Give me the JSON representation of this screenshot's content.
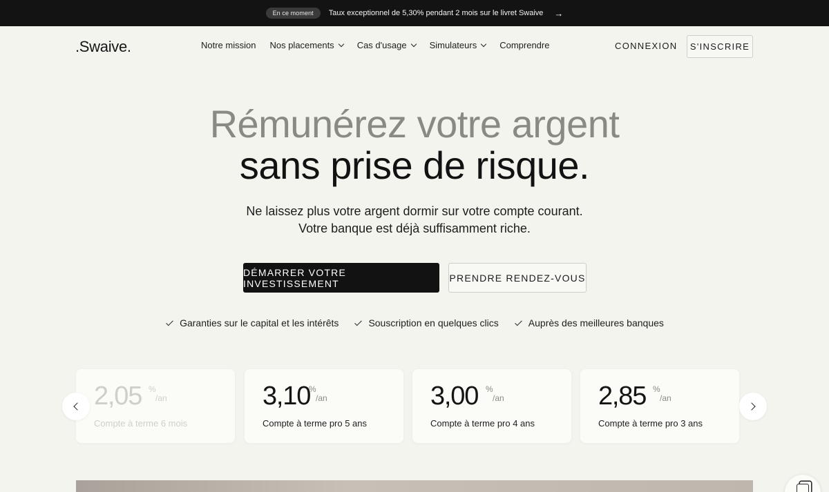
{
  "banner": {
    "badge": "En ce moment",
    "message": "Taux exceptionnel de 5,30% pendant 2 mois sur le livret Swaive",
    "arrow": "→"
  },
  "header": {
    "logo": ".Swaive.",
    "nav": [
      {
        "label": "Notre mission",
        "dropdown": false
      },
      {
        "label": "Nos placements",
        "dropdown": true
      },
      {
        "label": "Cas d'usage",
        "dropdown": true
      },
      {
        "label": "Simulateurs",
        "dropdown": true
      },
      {
        "label": "Comprendre",
        "dropdown": false
      }
    ],
    "login": "CONNEXION",
    "signup": "S'INSCRIRE"
  },
  "hero": {
    "line1": "Rémunérez votre argent",
    "line2": "sans prise de risque.",
    "sub1": "Ne laissez plus votre argent dormir sur votre compte courant.",
    "sub2": "Votre banque est déjà suffisamment riche.",
    "cta_primary": "DÉMARRER VOTRE INVESTISSEMENT",
    "cta_secondary": "PRENDRE RENDEZ-VOUS"
  },
  "features": [
    "Garanties sur le capital et les intérêts",
    "Souscription en quelques clics",
    "Auprès des meilleures banques"
  ],
  "cards": [
    {
      "rate": "2,05",
      "unit_pct": "%",
      "unit_per": "/an",
      "label": "Compte à terme 6 mois"
    },
    {
      "rate": "3,10",
      "unit_pct": "%",
      "unit_per": "/an",
      "label": "Compte à terme pro 5 ans"
    },
    {
      "rate": "3,00",
      "unit_pct": "%",
      "unit_per": "/an",
      "label": "Compte à terme pro 4 ans"
    },
    {
      "rate": "2,85",
      "unit_pct": "%",
      "unit_per": "/an",
      "label": "Compte à terme pro 3 ans"
    }
  ],
  "colors": {
    "banner_bg": "#131313",
    "page_bg": "#f4f4ef",
    "primary_button": "#121212",
    "muted_text": "#8a8a84"
  },
  "icons": {
    "carousel_prev": "chevron-left-icon",
    "carousel_next": "chevron-right-icon",
    "feature_check": "check-icon",
    "chat": "chat-icon"
  }
}
